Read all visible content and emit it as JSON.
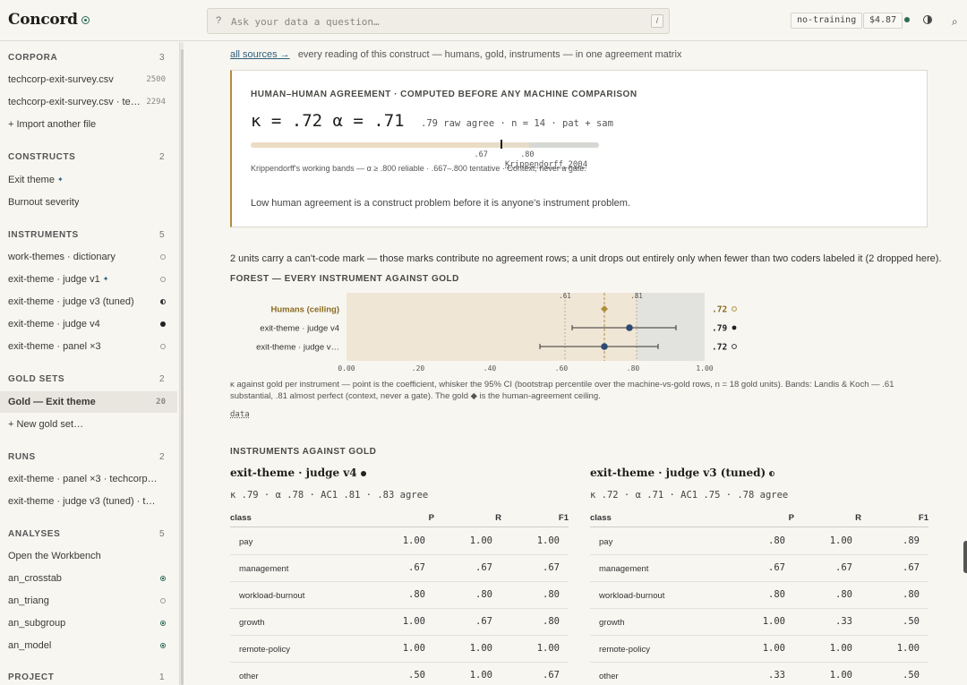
{
  "app": {
    "name": "Concord"
  },
  "search": {
    "placeholder": "Ask your data a question…",
    "prefix": "?",
    "shortcut": "/"
  },
  "topbar": {
    "training": "no-training",
    "cost": "$4.87"
  },
  "sidebar": {
    "corpora": {
      "title": "CORPORA",
      "count": "3",
      "items": [
        {
          "label": "techcorp-exit-survey.csv",
          "count": "2500"
        },
        {
          "label": "techcorp-exit-survey.csv · tex…",
          "count": "2294"
        },
        {
          "label": "+ Import another file"
        }
      ]
    },
    "constructs": {
      "title": "CONSTRUCTS",
      "count": "2",
      "items": [
        {
          "label": "Exit theme",
          "star": "✦"
        },
        {
          "label": "Burnout severity"
        }
      ]
    },
    "instruments": {
      "title": "INSTRUMENTS",
      "count": "5",
      "items": [
        {
          "label": "work-themes · dictionary"
        },
        {
          "label": "exit-theme · judge v1",
          "star": "✦"
        },
        {
          "label": "exit-theme · judge v3 (tuned)"
        },
        {
          "label": "exit-theme · judge v4"
        },
        {
          "label": "exit-theme · panel ×3"
        }
      ]
    },
    "gold": {
      "title": "GOLD SETS",
      "count": "2",
      "items": [
        {
          "label": "Gold — Exit theme",
          "count": "20"
        },
        {
          "label": "+ New gold set…"
        }
      ]
    },
    "runs": {
      "title": "RUNS",
      "count": "2",
      "items": [
        {
          "label": "exit-theme · panel ×3 · techcorp-…"
        },
        {
          "label": "exit-theme · judge v3 (tuned) · t…"
        }
      ]
    },
    "analyses": {
      "title": "ANALYSES",
      "count": "5",
      "items": [
        {
          "label": "Open the Workbench"
        },
        {
          "label": "an_crosstab"
        },
        {
          "label": "an_triang"
        },
        {
          "label": "an_subgroup"
        },
        {
          "label": "an_model"
        }
      ]
    },
    "project": {
      "title": "PROJECT",
      "count": "1"
    }
  },
  "main": {
    "crumb_link": "all sources →",
    "crumb_text": "every reading of this construct — humans, gold, instruments — in one agreement matrix",
    "card": {
      "title": "HUMAN–HUMAN AGREEMENT · COMPUTED BEFORE ANY MACHINE COMPARISON",
      "big": "κ = .72 α = .71",
      "sub": ".79 raw agree · n = 14 · pat + sam",
      "tick1": ".67",
      "tick2": ".80",
      "kappa": 0.72,
      "note": "Krippendorff's working bands — α ≥ .800 reliable · .667–.800 tentative · Context, never a gate.",
      "cite": "Krippendorff 2004",
      "message": "Low human agreement is a construct problem before it is anyone's instrument problem."
    },
    "unit_note": "2 units carry a can't-code mark — those marks contribute no agreement rows; a unit drops out entirely only when fewer than two coders labeled it (2 dropped here).",
    "forest_title": "FOREST — EVERY INSTRUMENT AGAINST GOLD",
    "forest_caption": "κ against gold per instrument — point is the coefficient, whisker the 95% CI (bootstrap percentile over the machine-vs-gold rows, n = 18 gold units). Bands: Landis & Koch — .61 substantial, .81 almost perfect (context, never a gate). The gold ◆ is the human-agreement ceiling.",
    "data_link": "data",
    "instruments_title": "INSTRUMENTS AGAINST GOLD",
    "table_head": {
      "class": "class",
      "p": "P",
      "r": "R",
      "f1": "F1"
    }
  },
  "chart_data": {
    "type": "scatter",
    "title": "FOREST — EVERY INSTRUMENT AGAINST GOLD",
    "xlim": [
      0,
      1
    ],
    "xticks": [
      "0.00",
      ".20",
      ".40",
      ".60",
      ".80",
      "1.00"
    ],
    "bands": [
      ".61",
      ".81"
    ],
    "rows": [
      {
        "name": "Humans (ceiling)",
        "value": 0.72,
        "label": ".72",
        "ci": null,
        "ceiling": true
      },
      {
        "name": "exit-theme · judge v4",
        "value": 0.79,
        "label": ".79",
        "ci": [
          0.63,
          0.92
        ]
      },
      {
        "name": "exit-theme · judge v…",
        "value": 0.72,
        "label": ".72",
        "ci": [
          0.54,
          0.87
        ]
      }
    ]
  },
  "panels": [
    {
      "name": "exit-theme · judge v4",
      "stats": "κ .79 · α .78 · AC1 .81 · .83 agree",
      "rows": [
        {
          "class": "pay",
          "p": "1.00",
          "r": "1.00",
          "f1": "1.00"
        },
        {
          "class": "management",
          "p": ".67",
          "r": ".67",
          "f1": ".67"
        },
        {
          "class": "workload-burnout",
          "p": ".80",
          "r": ".80",
          "f1": ".80"
        },
        {
          "class": "growth",
          "p": "1.00",
          "r": ".67",
          "f1": ".80"
        },
        {
          "class": "remote-policy",
          "p": "1.00",
          "r": "1.00",
          "f1": "1.00"
        },
        {
          "class": "other",
          "p": ".50",
          "r": "1.00",
          "f1": ".67"
        }
      ]
    },
    {
      "name": "exit-theme · judge v3 (tuned)",
      "stats": "κ .72 · α .71 · AC1 .75 · .78 agree",
      "rows": [
        {
          "class": "pay",
          "p": ".80",
          "r": "1.00",
          "f1": ".89"
        },
        {
          "class": "management",
          "p": ".67",
          "r": ".67",
          "f1": ".67"
        },
        {
          "class": "workload-burnout",
          "p": ".80",
          "r": ".80",
          "f1": ".80"
        },
        {
          "class": "growth",
          "p": "1.00",
          "r": ".33",
          "f1": ".50"
        },
        {
          "class": "remote-policy",
          "p": "1.00",
          "r": "1.00",
          "f1": "1.00"
        },
        {
          "class": "other",
          "p": ".33",
          "r": "1.00",
          "f1": ".50"
        }
      ]
    }
  ]
}
